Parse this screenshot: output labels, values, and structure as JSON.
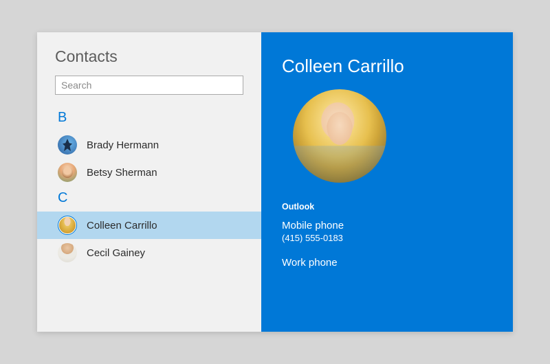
{
  "sidebar": {
    "title": "Contacts",
    "search_placeholder": "Search",
    "groups": [
      {
        "letter": "B",
        "items": [
          {
            "name": "Brady Hermann"
          },
          {
            "name": "Betsy Sherman"
          }
        ]
      },
      {
        "letter": "C",
        "items": [
          {
            "name": "Colleen Carrillo",
            "selected": true
          },
          {
            "name": "Cecil Gainey"
          }
        ]
      }
    ]
  },
  "detail": {
    "name": "Colleen Carrillo",
    "section": "Outlook",
    "fields": [
      {
        "label": "Mobile phone",
        "value": "(415) 555-0183"
      },
      {
        "label": "Work phone"
      }
    ]
  },
  "colors": {
    "accent": "#0078d7",
    "selection": "#b2d7ef",
    "sidebar_bg": "#f1f1f1"
  }
}
